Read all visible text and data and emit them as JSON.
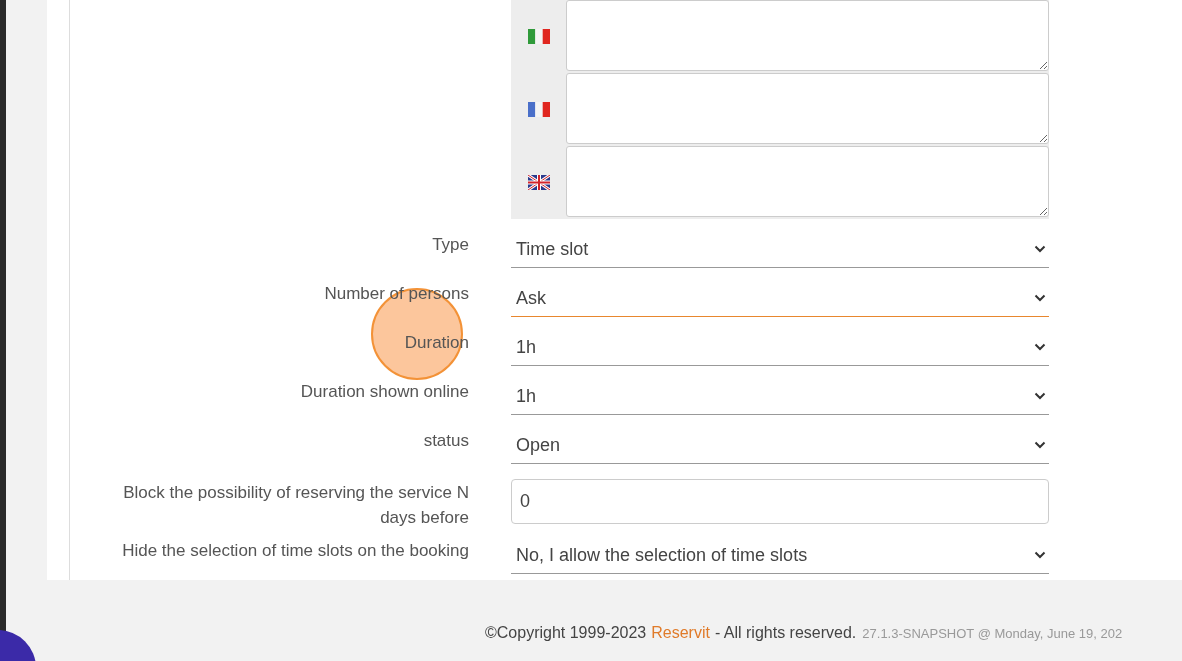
{
  "translations": [
    {
      "kind": "it"
    },
    {
      "kind": "fr"
    },
    {
      "kind": "gb"
    }
  ],
  "fields": [
    {
      "kind": "select",
      "label": "Type",
      "value": "Time slot",
      "focused": false
    },
    {
      "kind": "select",
      "label": "Number of persons",
      "value": "Ask",
      "focused": true
    },
    {
      "kind": "select",
      "label": "Duration",
      "value": "1h",
      "focused": false
    },
    {
      "kind": "select",
      "label": "Duration shown online",
      "value": "1h",
      "focused": false
    },
    {
      "kind": "select",
      "label": "status",
      "value": "Open",
      "focused": false
    },
    {
      "kind": "input",
      "label": "Block the possibility of reserving the service N days before",
      "value": "0",
      "focused": false
    },
    {
      "kind": "select",
      "label": "Hide the selection of time slots on the booking",
      "value": "No, I allow the selection of time slots",
      "focused": false
    }
  ],
  "footer": {
    "copyright": "©Copyright 1999-2023",
    "brand": "Reservit",
    "rights": "- All rights reserved.",
    "version": "27.1.3-SNAPSHOT @ Monday, June 19, 202"
  }
}
